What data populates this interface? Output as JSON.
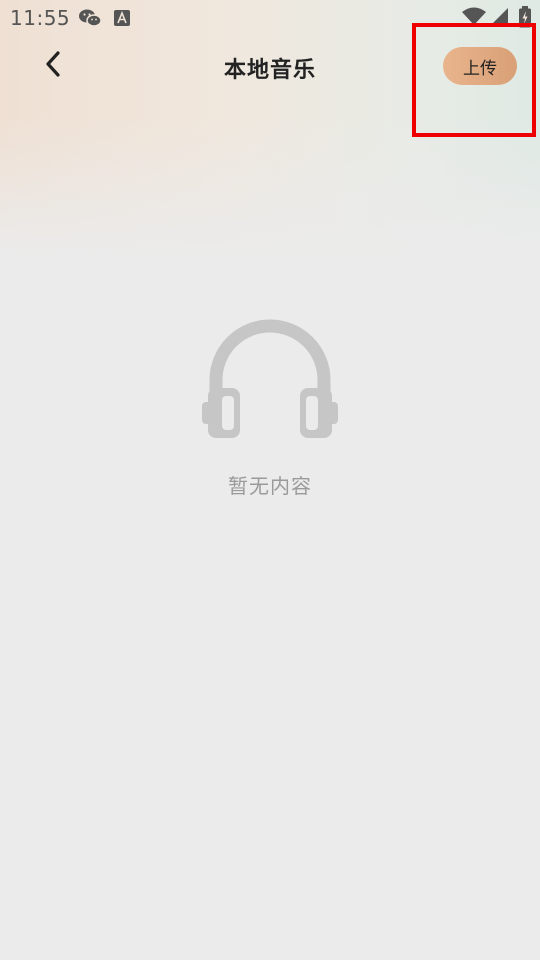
{
  "status_bar": {
    "time": "11:55",
    "icons": [
      "wechat-icon",
      "a-icon",
      "wifi-icon",
      "signal-icon",
      "battery-icon"
    ]
  },
  "app_bar": {
    "back_icon": "chevron-left-icon",
    "title": "本地音乐",
    "upload_label": "上传"
  },
  "empty_state": {
    "icon": "headphones-icon",
    "text": "暂无内容"
  },
  "colors": {
    "accent_gradient_start": "#e9b48c",
    "accent_gradient_end": "#d9a077",
    "background": "#ebebeb",
    "highlight": "#ee0000"
  }
}
